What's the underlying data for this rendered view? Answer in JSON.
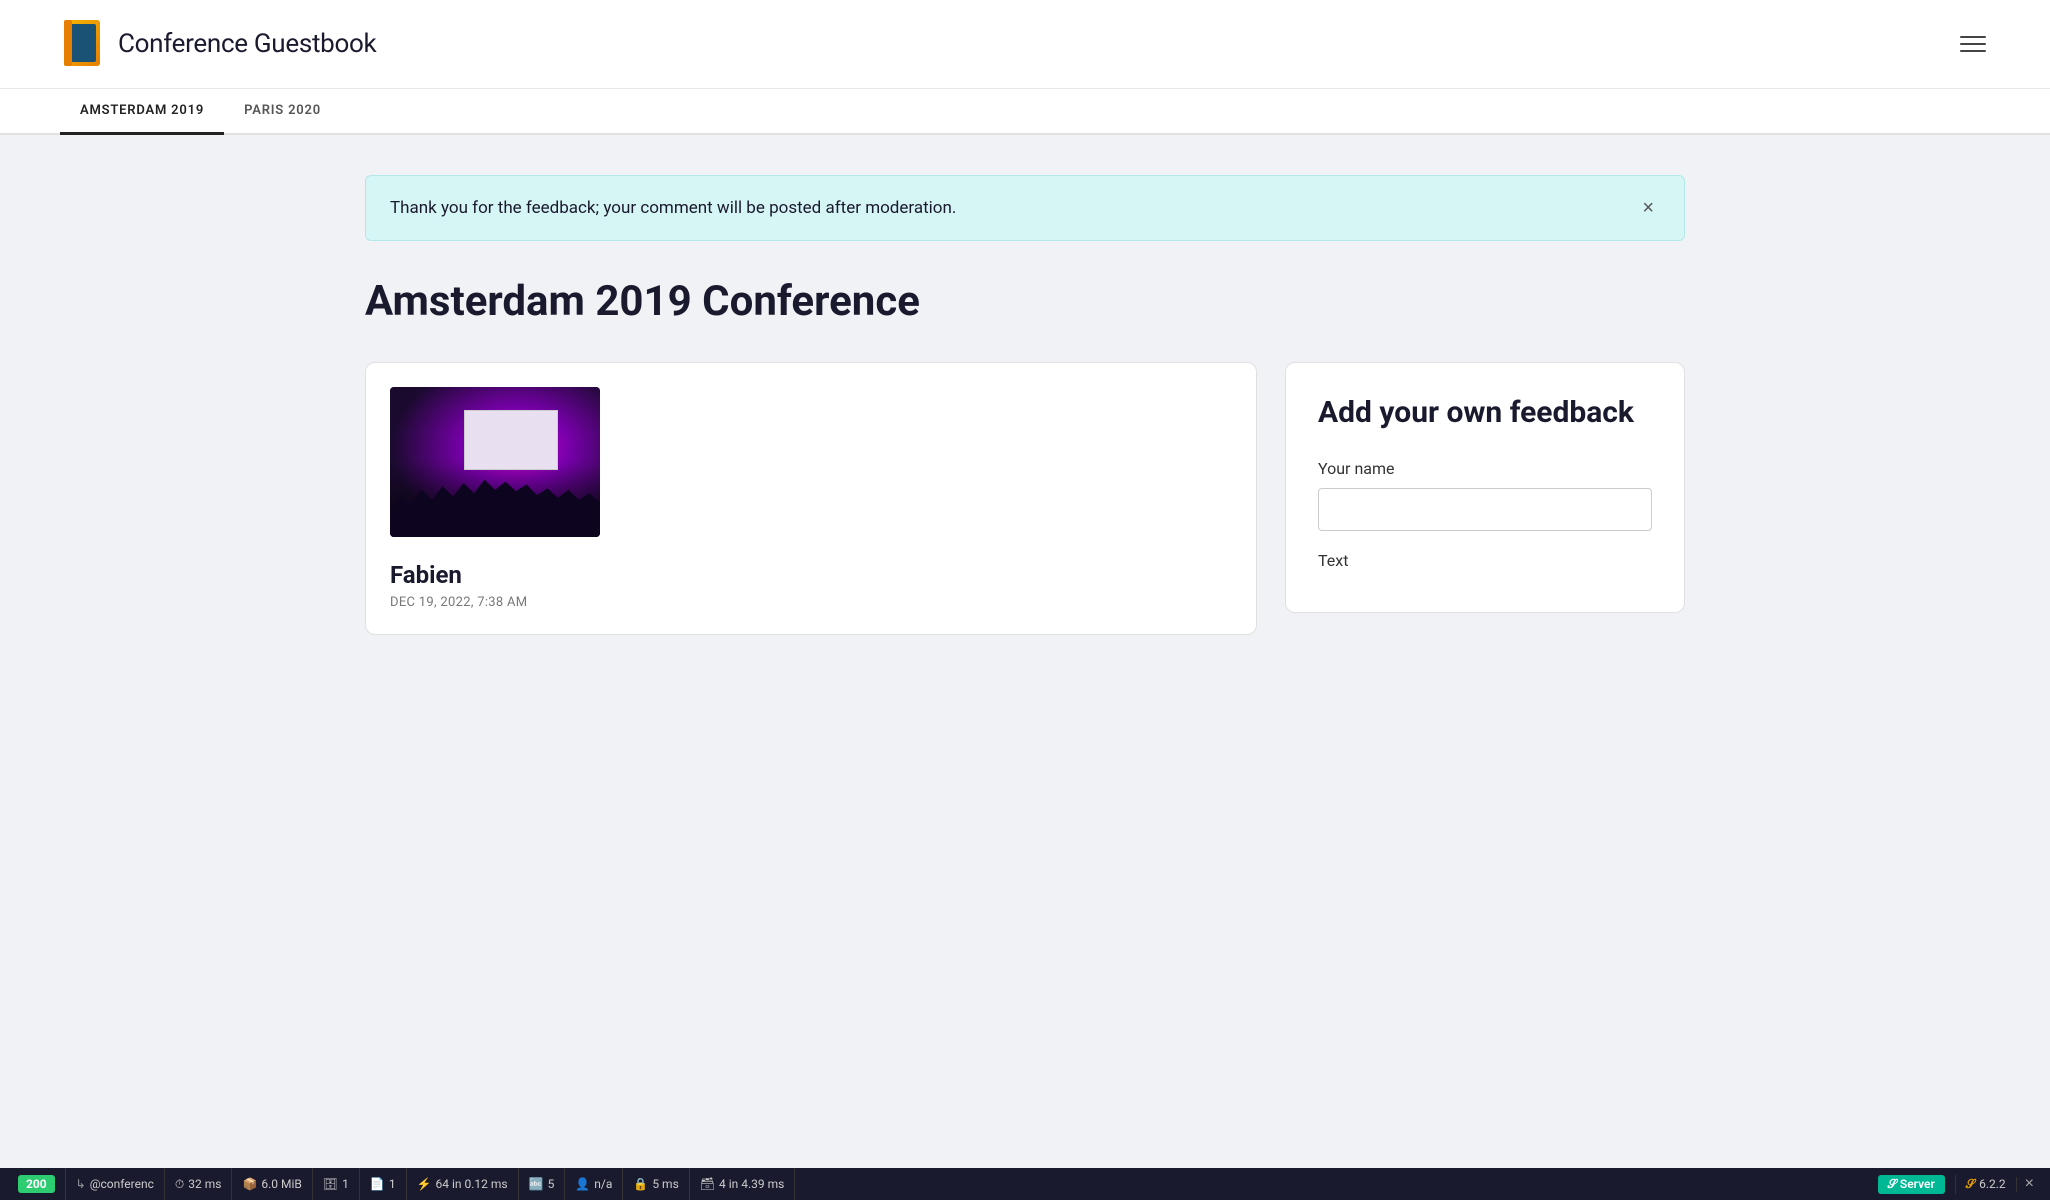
{
  "header": {
    "app_title": "Conference Guestbook",
    "logo_alt": "guestbook-logo"
  },
  "nav": {
    "tabs": [
      {
        "id": "amsterdam",
        "label": "AMSTERDAM 2019",
        "active": true
      },
      {
        "id": "paris",
        "label": "PARIS 2020",
        "active": false
      }
    ]
  },
  "alert": {
    "message": "Thank you for the feedback; your comment will be posted after moderation.",
    "close_label": "×"
  },
  "page": {
    "title": "Amsterdam 2019 Conference"
  },
  "comment": {
    "author": "Fabien",
    "date": "DEC 19, 2022, 7:38 AM"
  },
  "feedback_form": {
    "title": "Add your own feedback",
    "name_label": "Your name",
    "name_placeholder": "",
    "text_label": "Text"
  },
  "status_bar": {
    "http_code": "200",
    "route": "@conferenc",
    "time_ms": "32 ms",
    "memory": "6.0 MiB",
    "db_icon": "📊",
    "db_count": "1",
    "file_icon": "📄",
    "file_count": "1",
    "events_label": "64 in 0.12 ms",
    "translations_count": "5",
    "user_label": "n/a",
    "security_ms": "5 ms",
    "db_queries": "4 in 4.39 ms",
    "server_label": "Server",
    "version_label": "6.2.2"
  }
}
